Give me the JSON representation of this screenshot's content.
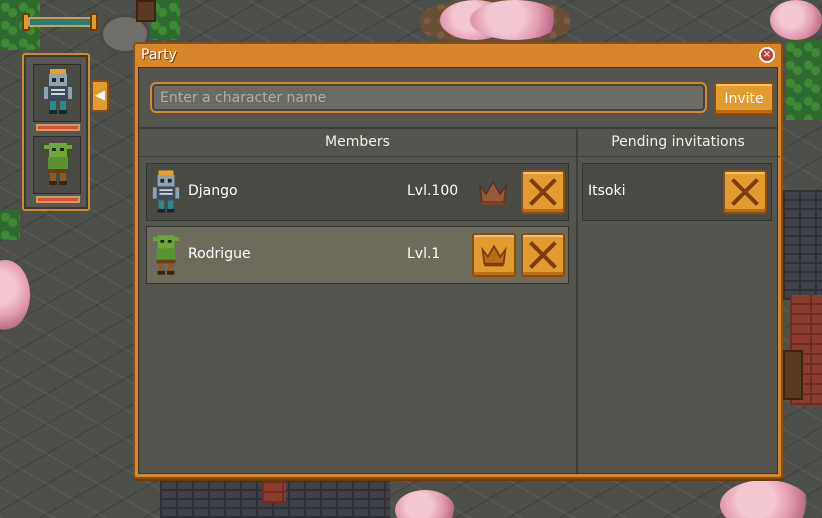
{
  "window": {
    "title": "Party"
  },
  "search": {
    "placeholder": "Enter a character name",
    "value": ""
  },
  "invite_label": "Invite",
  "columns": {
    "members": "Members",
    "pending": "Pending invitations"
  },
  "members": [
    {
      "name": "Django",
      "level": "Lvl.100",
      "is_leader": true
    },
    {
      "name": "Rodrigue",
      "level": "Lvl.1",
      "is_leader": false
    }
  ],
  "pending": [
    {
      "name": "Itsoki"
    }
  ],
  "colors": {
    "accent": "#e39a2e",
    "panel": "#55554f",
    "row": "#4a4a45",
    "row_selected": "#6c6b5c"
  },
  "icons": [
    "close-icon",
    "collapse-arrow-icon",
    "crown-icon",
    "x-icon"
  ]
}
